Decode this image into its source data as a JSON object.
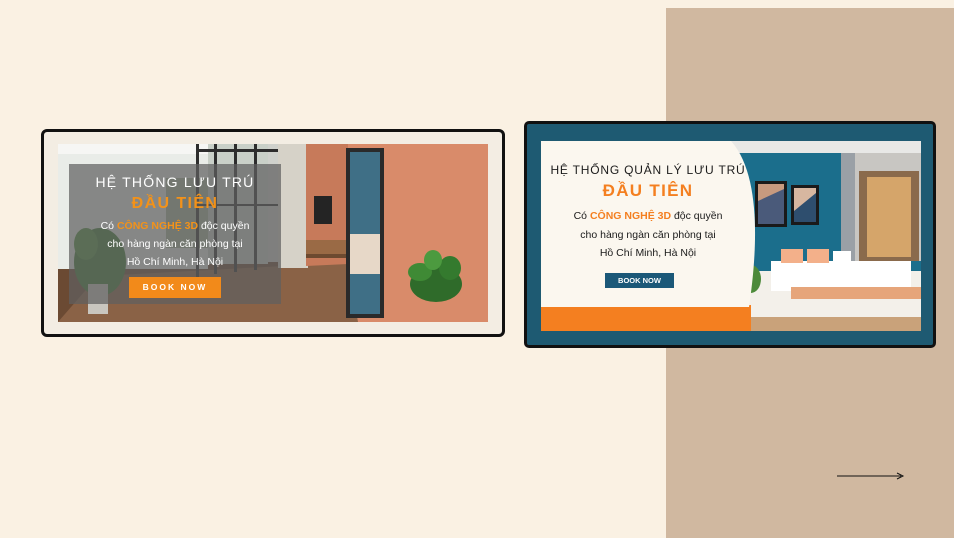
{
  "colors": {
    "background": "#faf1e3",
    "right_panel": "#d0b8a0",
    "accent_orange": "#f39219",
    "banner2_teal": "#1e5a72",
    "button_navy": "#1b5878"
  },
  "banner1": {
    "title": "HỆ THỐNG LƯU TRÚ",
    "accent": "ĐẦU TIÊN",
    "desc_prefix": "Có",
    "desc_highlight": "CÔNG NGHỆ 3D",
    "desc_suffix": "độc quyền",
    "desc_line2": "cho hàng ngàn căn phòng tại",
    "desc_line3": "Hồ Chí Minh, Hà Nội",
    "button": "BOOK NOW"
  },
  "banner2": {
    "title": "HỆ THỐNG QUẢN LÝ LƯU TRÚ",
    "accent": "ĐẦU TIÊN",
    "desc_prefix": "Có",
    "desc_highlight": "CÔNG NGHỆ 3D",
    "desc_suffix": "độc quyền",
    "desc_line2": "cho hàng ngàn căn phòng tại",
    "desc_line3": "Hồ Chí Minh, Hà Nội",
    "button": "BOOK NOW"
  },
  "icons": {
    "arrow": "arrow-right-icon"
  }
}
